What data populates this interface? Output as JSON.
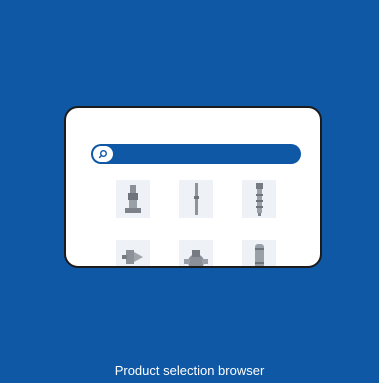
{
  "tile": {
    "background_color": "#0e58a6",
    "caption": "Product selection browser"
  },
  "browser_card": {
    "search_bar_color": "#0e58a6",
    "search_icon": "search-icon",
    "thumbnails": [
      {
        "icon": "vertical-inline-pump-icon"
      },
      {
        "icon": "slim-shaft-pump-icon"
      },
      {
        "icon": "multistage-borehole-pump-icon"
      },
      {
        "icon": "centrifugal-pump-icon"
      },
      {
        "icon": "end-suction-pump-icon"
      },
      {
        "icon": "submersible-pump-icon"
      }
    ]
  }
}
